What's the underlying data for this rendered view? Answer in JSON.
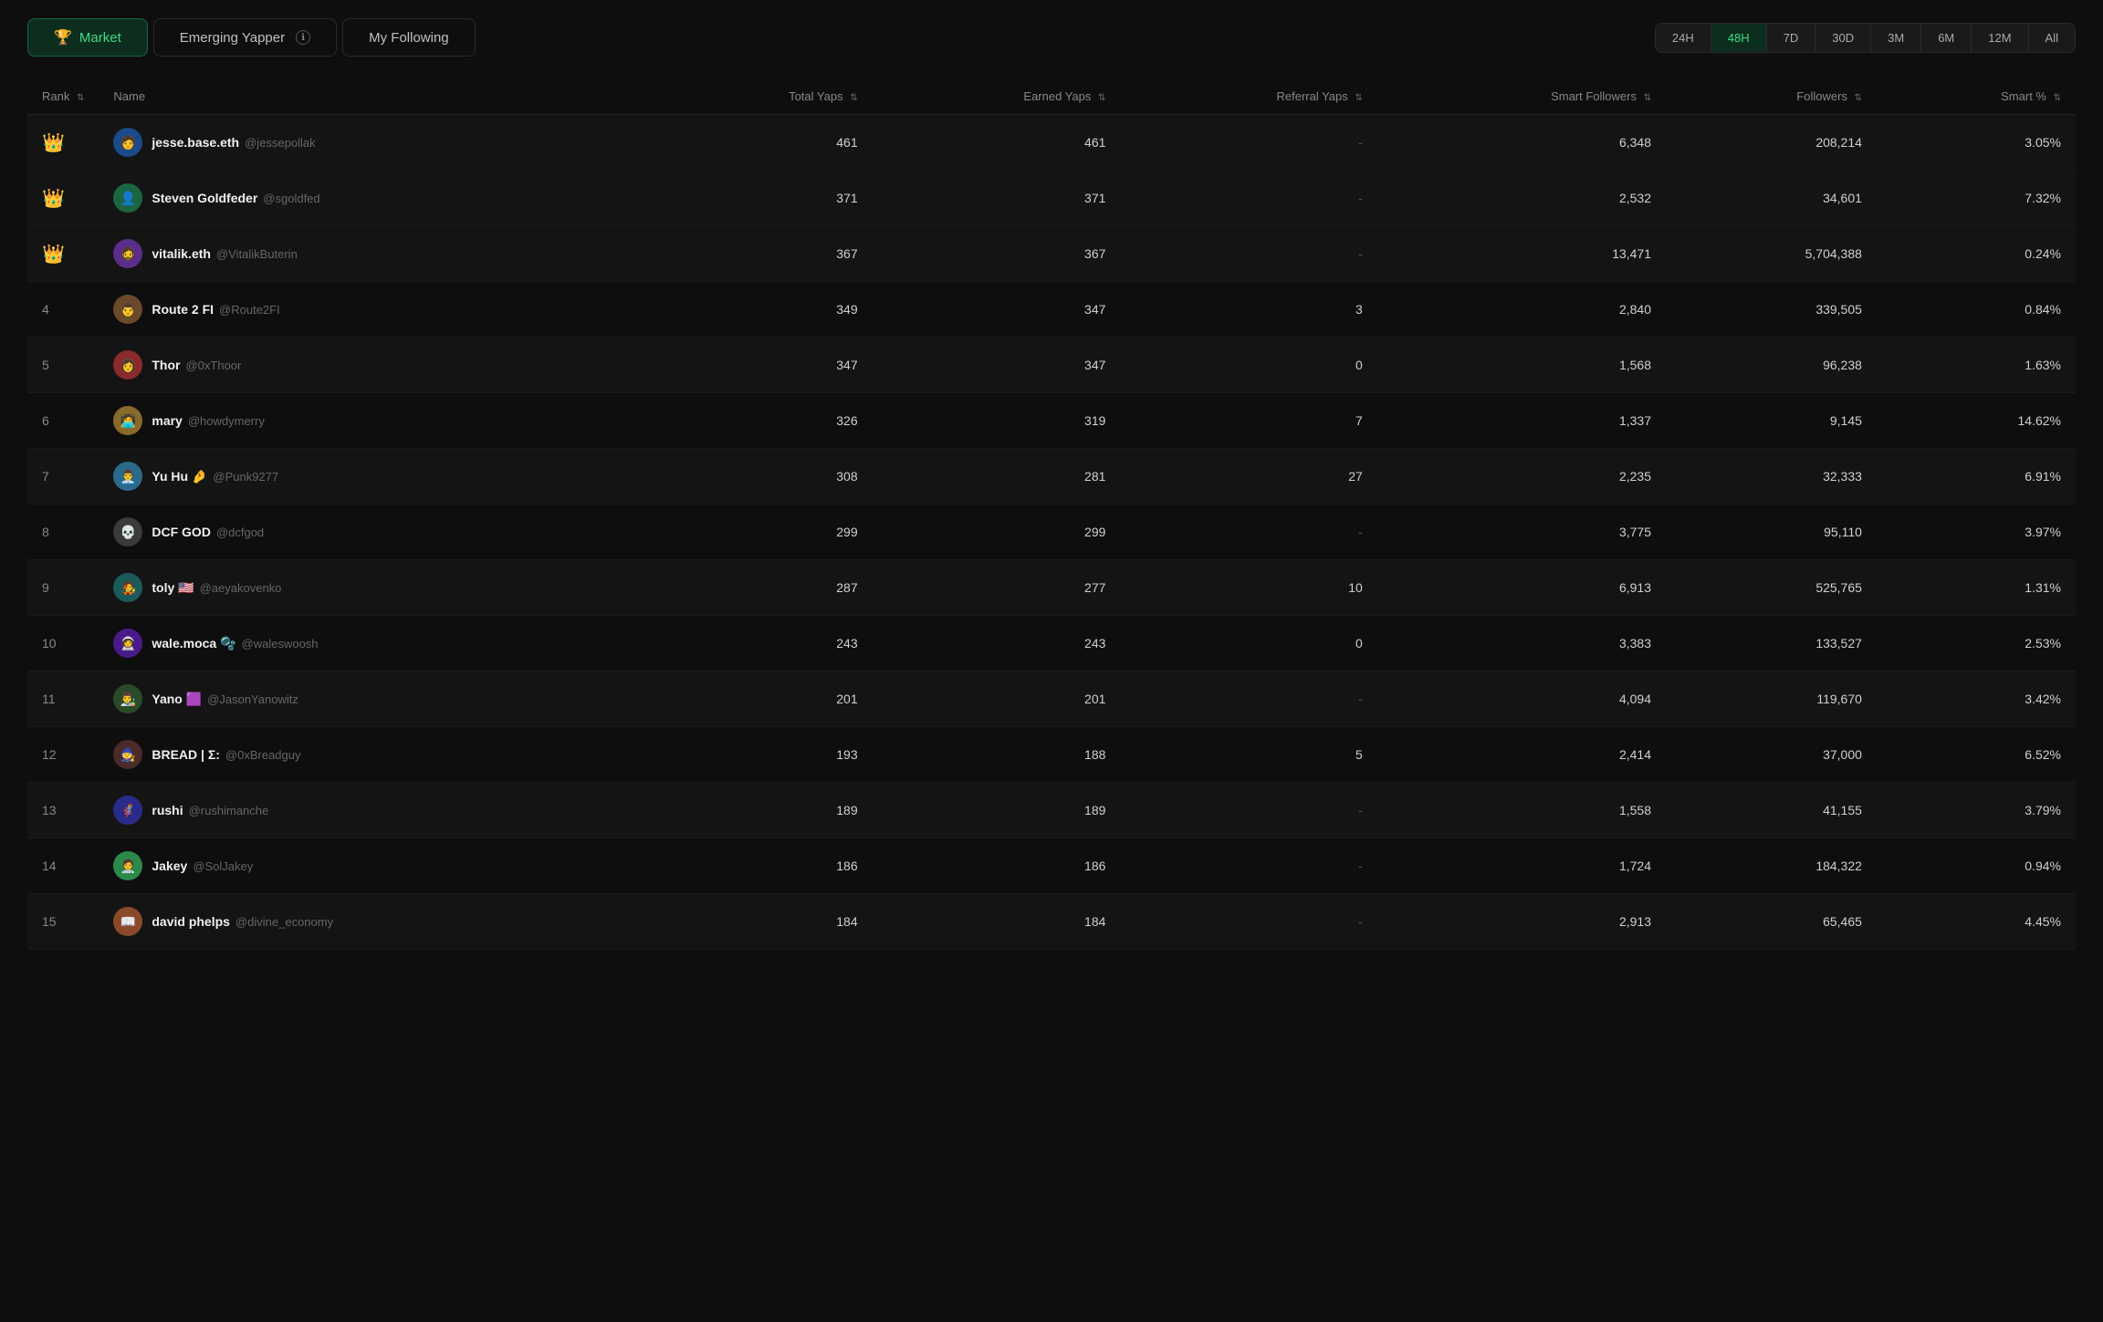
{
  "tabs": [
    {
      "id": "market",
      "label": "Market",
      "icon": "🏆",
      "active": true
    },
    {
      "id": "emerging",
      "label": "Emerging Yapper",
      "info": true,
      "active": false
    },
    {
      "id": "following",
      "label": "My Following",
      "active": false
    }
  ],
  "time_filters": [
    {
      "id": "24h",
      "label": "24H",
      "active": false
    },
    {
      "id": "48h",
      "label": "48H",
      "active": true
    },
    {
      "id": "7d",
      "label": "7D",
      "active": false
    },
    {
      "id": "30d",
      "label": "30D",
      "active": false
    },
    {
      "id": "3m",
      "label": "3M",
      "active": false
    },
    {
      "id": "6m",
      "label": "6M",
      "active": false
    },
    {
      "id": "12m",
      "label": "12M",
      "active": false
    },
    {
      "id": "all",
      "label": "All",
      "active": false
    }
  ],
  "columns": [
    {
      "id": "rank",
      "label": "Rank",
      "sortable": true
    },
    {
      "id": "name",
      "label": "Name",
      "sortable": false
    },
    {
      "id": "total_yaps",
      "label": "Total Yaps",
      "sortable": true
    },
    {
      "id": "earned_yaps",
      "label": "Earned Yaps",
      "sortable": true
    },
    {
      "id": "referral_yaps",
      "label": "Referral Yaps",
      "sortable": true
    },
    {
      "id": "smart_followers",
      "label": "Smart Followers",
      "sortable": true
    },
    {
      "id": "followers",
      "label": "Followers",
      "sortable": true
    },
    {
      "id": "smart_pct",
      "label": "Smart %",
      "sortable": true
    }
  ],
  "rows": [
    {
      "rank": "👑",
      "rank_type": "crown",
      "name": "jesse.base.eth",
      "handle": "@jessepollak",
      "avatar": "🟦",
      "total_yaps": "461",
      "earned_yaps": "461",
      "referral_yaps": "-",
      "smart_followers": "6,348",
      "followers": "208,214",
      "smart_pct": "3.05%",
      "highlighted": true
    },
    {
      "rank": "👑",
      "rank_type": "crown",
      "name": "Steven Goldfeder",
      "handle": "@sgoldfed",
      "avatar": "🟩",
      "total_yaps": "371",
      "earned_yaps": "371",
      "referral_yaps": "-",
      "smart_followers": "2,532",
      "followers": "34,601",
      "smart_pct": "7.32%",
      "highlighted": true
    },
    {
      "rank": "👑",
      "rank_type": "crown",
      "name": "vitalik.eth",
      "handle": "@VitalikButerin",
      "avatar": "🟪",
      "total_yaps": "367",
      "earned_yaps": "367",
      "referral_yaps": "-",
      "smart_followers": "13,471",
      "followers": "5,704,388",
      "smart_pct": "0.24%",
      "highlighted": true
    },
    {
      "rank": "4",
      "rank_type": "number",
      "name": "Route 2 FI",
      "handle": "@Route2FI",
      "avatar": "⬜",
      "total_yaps": "349",
      "earned_yaps": "347",
      "referral_yaps": "3",
      "smart_followers": "2,840",
      "followers": "339,505",
      "smart_pct": "0.84%",
      "highlighted": false
    },
    {
      "rank": "5",
      "rank_type": "number",
      "name": "Thor",
      "handle": "@0xThoor",
      "avatar": "🟧",
      "total_yaps": "347",
      "earned_yaps": "347",
      "referral_yaps": "0",
      "smart_followers": "1,568",
      "followers": "96,238",
      "smart_pct": "1.63%",
      "highlighted": true
    },
    {
      "rank": "6",
      "rank_type": "number",
      "name": "mary",
      "handle": "@howdymerry",
      "avatar": "🔴",
      "total_yaps": "326",
      "earned_yaps": "319",
      "referral_yaps": "7",
      "smart_followers": "1,337",
      "followers": "9,145",
      "smart_pct": "14.62%",
      "highlighted": false
    },
    {
      "rank": "7",
      "rank_type": "number",
      "name": "Yu Hu 🤌",
      "handle": "@Punk9277",
      "avatar": "🟡",
      "total_yaps": "308",
      "earned_yaps": "281",
      "referral_yaps": "27",
      "smart_followers": "2,235",
      "followers": "32,333",
      "smart_pct": "6.91%",
      "highlighted": true
    },
    {
      "rank": "8",
      "rank_type": "number",
      "name": "DCF GOD",
      "handle": "@dcfgod",
      "avatar": "💀",
      "total_yaps": "299",
      "earned_yaps": "299",
      "referral_yaps": "-",
      "smart_followers": "3,775",
      "followers": "95,110",
      "smart_pct": "3.97%",
      "highlighted": false
    },
    {
      "rank": "9",
      "rank_type": "number",
      "name": "toly 🇺🇸",
      "handle": "@aeyakovenko",
      "avatar": "🟦",
      "total_yaps": "287",
      "earned_yaps": "277",
      "referral_yaps": "10",
      "smart_followers": "6,913",
      "followers": "525,765",
      "smart_pct": "1.31%",
      "highlighted": true
    },
    {
      "rank": "10",
      "rank_type": "number",
      "name": "wale.moca 🫧",
      "handle": "@waleswoosh",
      "avatar": "🟦",
      "total_yaps": "243",
      "earned_yaps": "243",
      "referral_yaps": "0",
      "smart_followers": "3,383",
      "followers": "133,527",
      "smart_pct": "2.53%",
      "highlighted": false
    },
    {
      "rank": "11",
      "rank_type": "number",
      "name": "Yano 🟪",
      "handle": "@JasonYanowitz",
      "avatar": "🟩",
      "total_yaps": "201",
      "earned_yaps": "201",
      "referral_yaps": "-",
      "smart_followers": "4,094",
      "followers": "119,670",
      "smart_pct": "3.42%",
      "highlighted": true
    },
    {
      "rank": "12",
      "rank_type": "number",
      "name": "BREAD | Σ:",
      "handle": "@0xBreadguy",
      "avatar": "💀",
      "total_yaps": "193",
      "earned_yaps": "188",
      "referral_yaps": "5",
      "smart_followers": "2,414",
      "followers": "37,000",
      "smart_pct": "6.52%",
      "highlighted": false
    },
    {
      "rank": "13",
      "rank_type": "number",
      "name": "rushi",
      "handle": "@rushimanche",
      "avatar": "🟦",
      "total_yaps": "189",
      "earned_yaps": "189",
      "referral_yaps": "-",
      "smart_followers": "1,558",
      "followers": "41,155",
      "smart_pct": "3.79%",
      "highlighted": true
    },
    {
      "rank": "14",
      "rank_type": "number",
      "name": "Jakey",
      "handle": "@SolJakey",
      "avatar": "🟩",
      "total_yaps": "186",
      "earned_yaps": "186",
      "referral_yaps": "-",
      "smart_followers": "1,724",
      "followers": "184,322",
      "smart_pct": "0.94%",
      "highlighted": false
    },
    {
      "rank": "15",
      "rank_type": "number",
      "name": "david phelps",
      "handle": "@divine_economy",
      "avatar": "🟧",
      "total_yaps": "184",
      "earned_yaps": "184",
      "referral_yaps": "-",
      "smart_followers": "2,913",
      "followers": "65,465",
      "smart_pct": "4.45%",
      "highlighted": true
    }
  ]
}
